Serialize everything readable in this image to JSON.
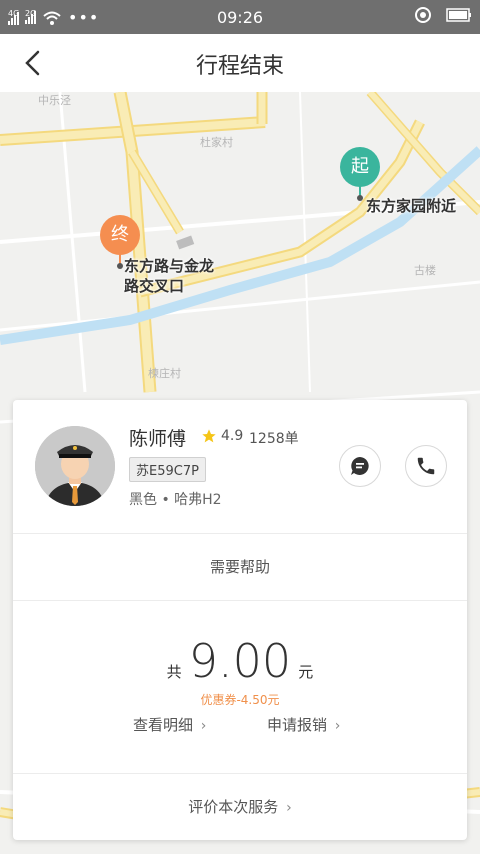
{
  "status_bar": {
    "sim1_label": "4G",
    "sim2_label": "2G",
    "time": "09:26",
    "icons": [
      "signal-icon",
      "wifi-icon",
      "more-icon",
      "location-icon",
      "battery-icon"
    ]
  },
  "header": {
    "title": "行程结束",
    "back_icon": "chevron-left-icon"
  },
  "map": {
    "place_labels": [
      "中乐泾",
      "杜家村",
      "古楼",
      "楝庄村"
    ],
    "start_pin": "起",
    "start_address": "东方家园附近",
    "end_pin": "终",
    "end_address_line1": "东方路与金龙",
    "end_address_line2": "路交叉口",
    "colors": {
      "start": "#3ab59d",
      "end": "#f58e50",
      "road": "#f7e7a7",
      "river": "#bfe0f4"
    }
  },
  "driver": {
    "name": "陈师傅",
    "rating": "4.9",
    "orders": "1258单",
    "plate": "苏E59C7P",
    "car": "黑色 • 哈弗H2"
  },
  "actions": {
    "message_icon": "message-icon",
    "phone_icon": "phone-icon"
  },
  "help_label": "需要帮助",
  "fare": {
    "prefix": "共",
    "amount": "9.00",
    "unit": "元",
    "coupon": "优惠券-4.50元",
    "detail_link": "查看明细",
    "reimburse_link": "申请报销"
  },
  "rate_service": "评价本次服务"
}
